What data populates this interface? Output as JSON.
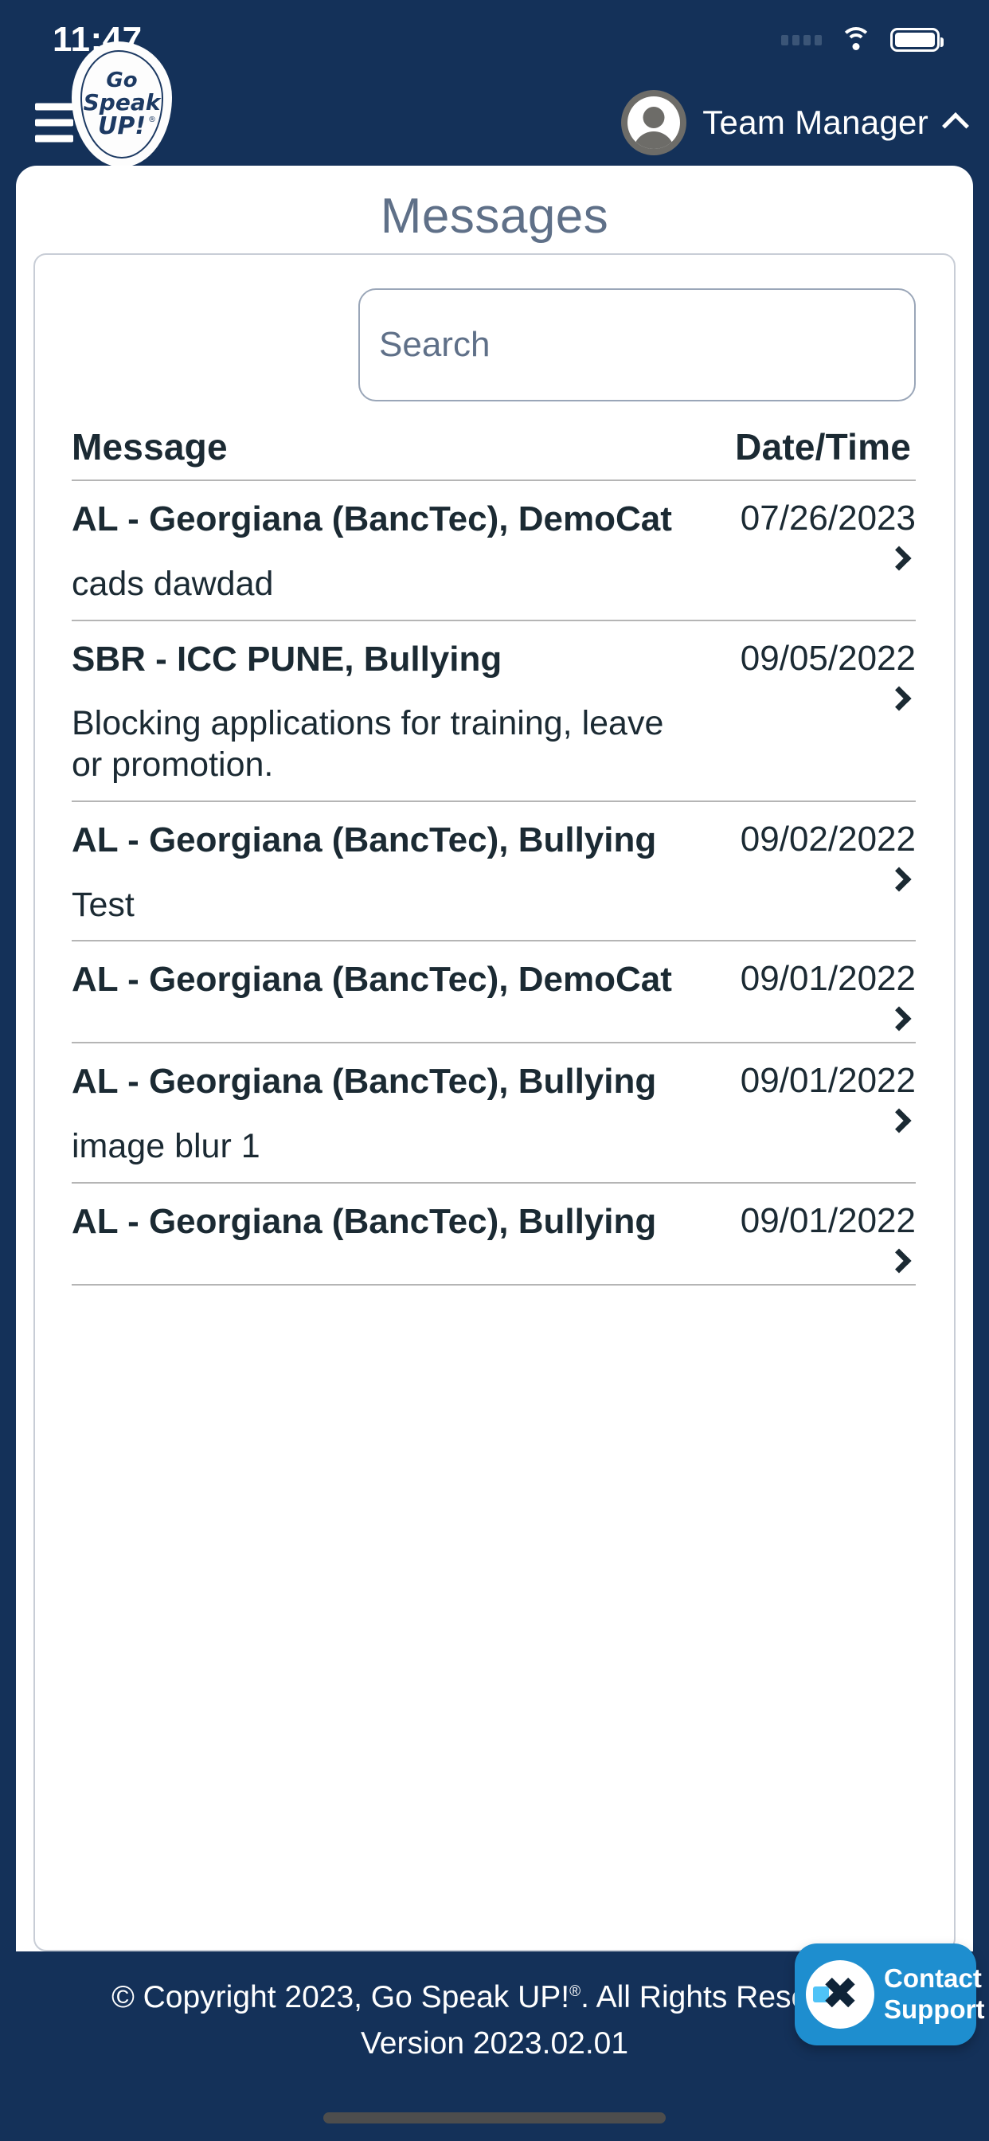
{
  "status_bar": {
    "time": "11:47",
    "signal_icon": "cellular-signal-icon",
    "wifi_icon": "wifi-icon",
    "battery_icon": "battery-full-icon"
  },
  "header": {
    "menu_icon": "hamburger-menu-icon",
    "logo": {
      "line1": "Go",
      "line2": "Speak",
      "line3": "UP!",
      "registered_mark": "®",
      "name": "go-speak-up-logo"
    },
    "profile": {
      "avatar_icon": "user-avatar-icon",
      "name": "Team Manager",
      "chevron_icon": "chevron-up-icon"
    }
  },
  "page": {
    "title": "Messages"
  },
  "search": {
    "value": "",
    "placeholder": "Search"
  },
  "table": {
    "columns": [
      "Message",
      "Date/Time"
    ],
    "rows": [
      {
        "title": "AL - Georgiana (BancTec), DemoCat",
        "preview": "cads dawdad",
        "date": "07/26/2023",
        "chevron_icon": "chevron-right-icon"
      },
      {
        "title": "SBR - ICC PUNE, Bullying",
        "preview": "Blocking applications for training, leave or promotion.",
        "date": "09/05/2022",
        "chevron_icon": "chevron-right-icon"
      },
      {
        "title": "AL - Georgiana (BancTec), Bullying",
        "preview": "Test",
        "date": "09/02/2022",
        "chevron_icon": "chevron-right-icon"
      },
      {
        "title": "AL - Georgiana (BancTec), DemoCat",
        "preview": "",
        "date": "09/01/2022",
        "chevron_icon": "chevron-right-icon"
      },
      {
        "title": "AL - Georgiana (BancTec), Bullying",
        "preview": "image blur 1",
        "date": "09/01/2022",
        "chevron_icon": "chevron-right-icon"
      },
      {
        "title": "AL - Georgiana (BancTec), Bullying",
        "preview": "",
        "date": "09/01/2022",
        "chevron_icon": "chevron-right-icon"
      }
    ]
  },
  "footer": {
    "copyright_prefix": "© Copyright 2023, Go Speak UP!",
    "copyright_mark": "®",
    "copyright_suffix": ".  All Rights Reserved.",
    "version": "Version 2023.02.01"
  },
  "support_button": {
    "line1": "Contact",
    "line2": "Support",
    "logo_icon": "support-x-logo-icon"
  },
  "colors": {
    "brand_navy": "#143159",
    "title_slate": "#5f7088",
    "text_dark": "#1b2a33",
    "divider": "#b5b5b5",
    "support_blue": "#1e8ecf",
    "support_accent": "#4fc3f7"
  }
}
